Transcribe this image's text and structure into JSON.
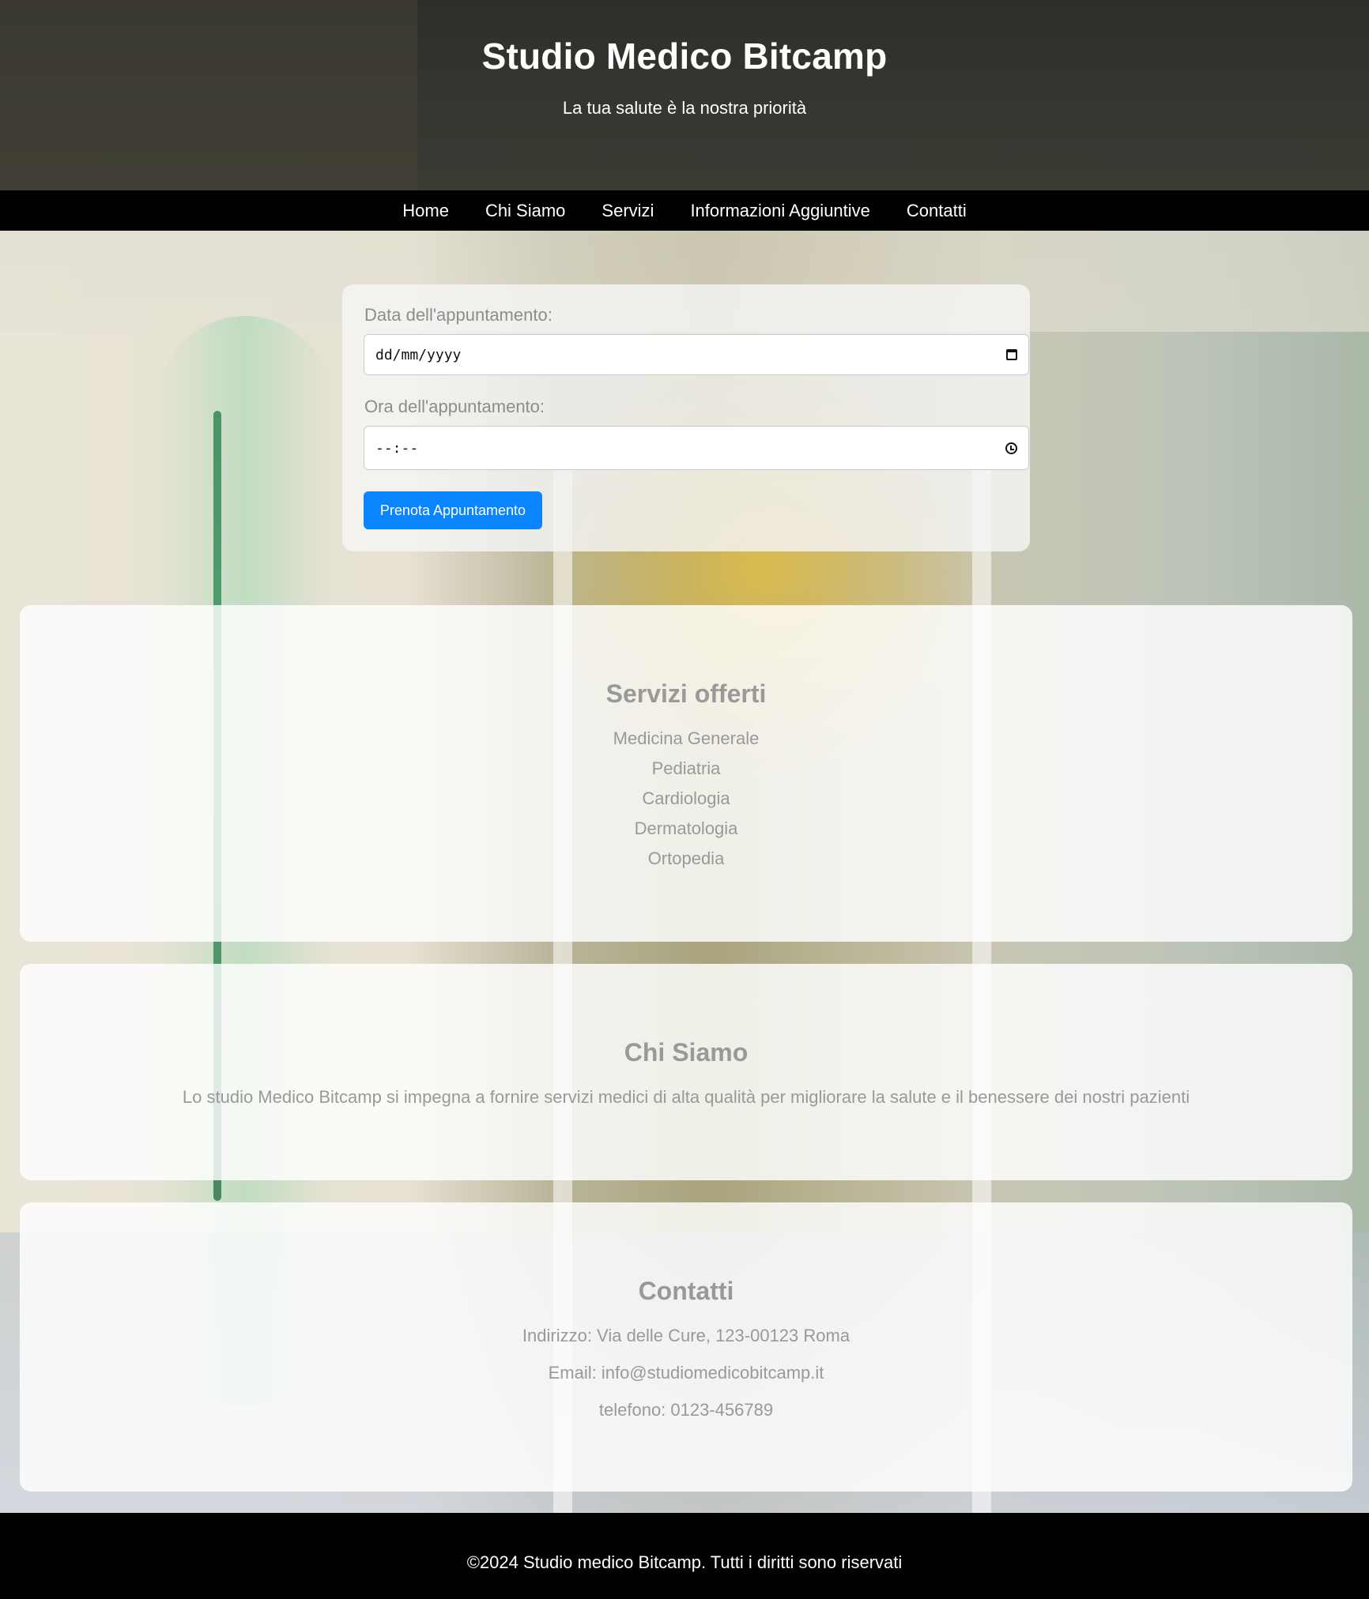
{
  "header": {
    "title": "Studio Medico Bitcamp",
    "tagline": "La tua salute è la nostra priorità"
  },
  "nav": {
    "items": [
      {
        "label": "Home"
      },
      {
        "label": "Chi Siamo"
      },
      {
        "label": "Servizi"
      },
      {
        "label": "Informazioni Aggiuntive"
      },
      {
        "label": "Contatti"
      }
    ]
  },
  "booking": {
    "date_label": "Data dell'appuntamento:",
    "date_placeholder": "dd/mm/yyyy",
    "time_label": "Ora dell'appuntamento:",
    "time_placeholder": "--:--",
    "submit_label": "Prenota Appuntamento",
    "submit_color": "#0a84ff"
  },
  "services": {
    "title": "Servizi offerti",
    "items": [
      "Medicina Generale",
      "Pediatria",
      "Cardiologia",
      "Dermatologia",
      "Ortopedia"
    ]
  },
  "about": {
    "title": "Chi Siamo",
    "text": "Lo studio Medico Bitcamp si impegna a fornire servizi medici di alta qualità per migliorare la salute e il benessere dei nostri pazienti"
  },
  "contacts": {
    "title": "Contatti",
    "address": "Indirizzo: Via delle Cure, 123-00123 Roma",
    "email": "Email: info@studiomedicobitcamp.it",
    "phone": "telefono: 0123-456789"
  },
  "footer": {
    "text": "©2024 Studio medico Bitcamp. Tutti i diritti sono riservati"
  },
  "icons": {
    "date": "calendar-icon",
    "time": "clock-icon"
  }
}
